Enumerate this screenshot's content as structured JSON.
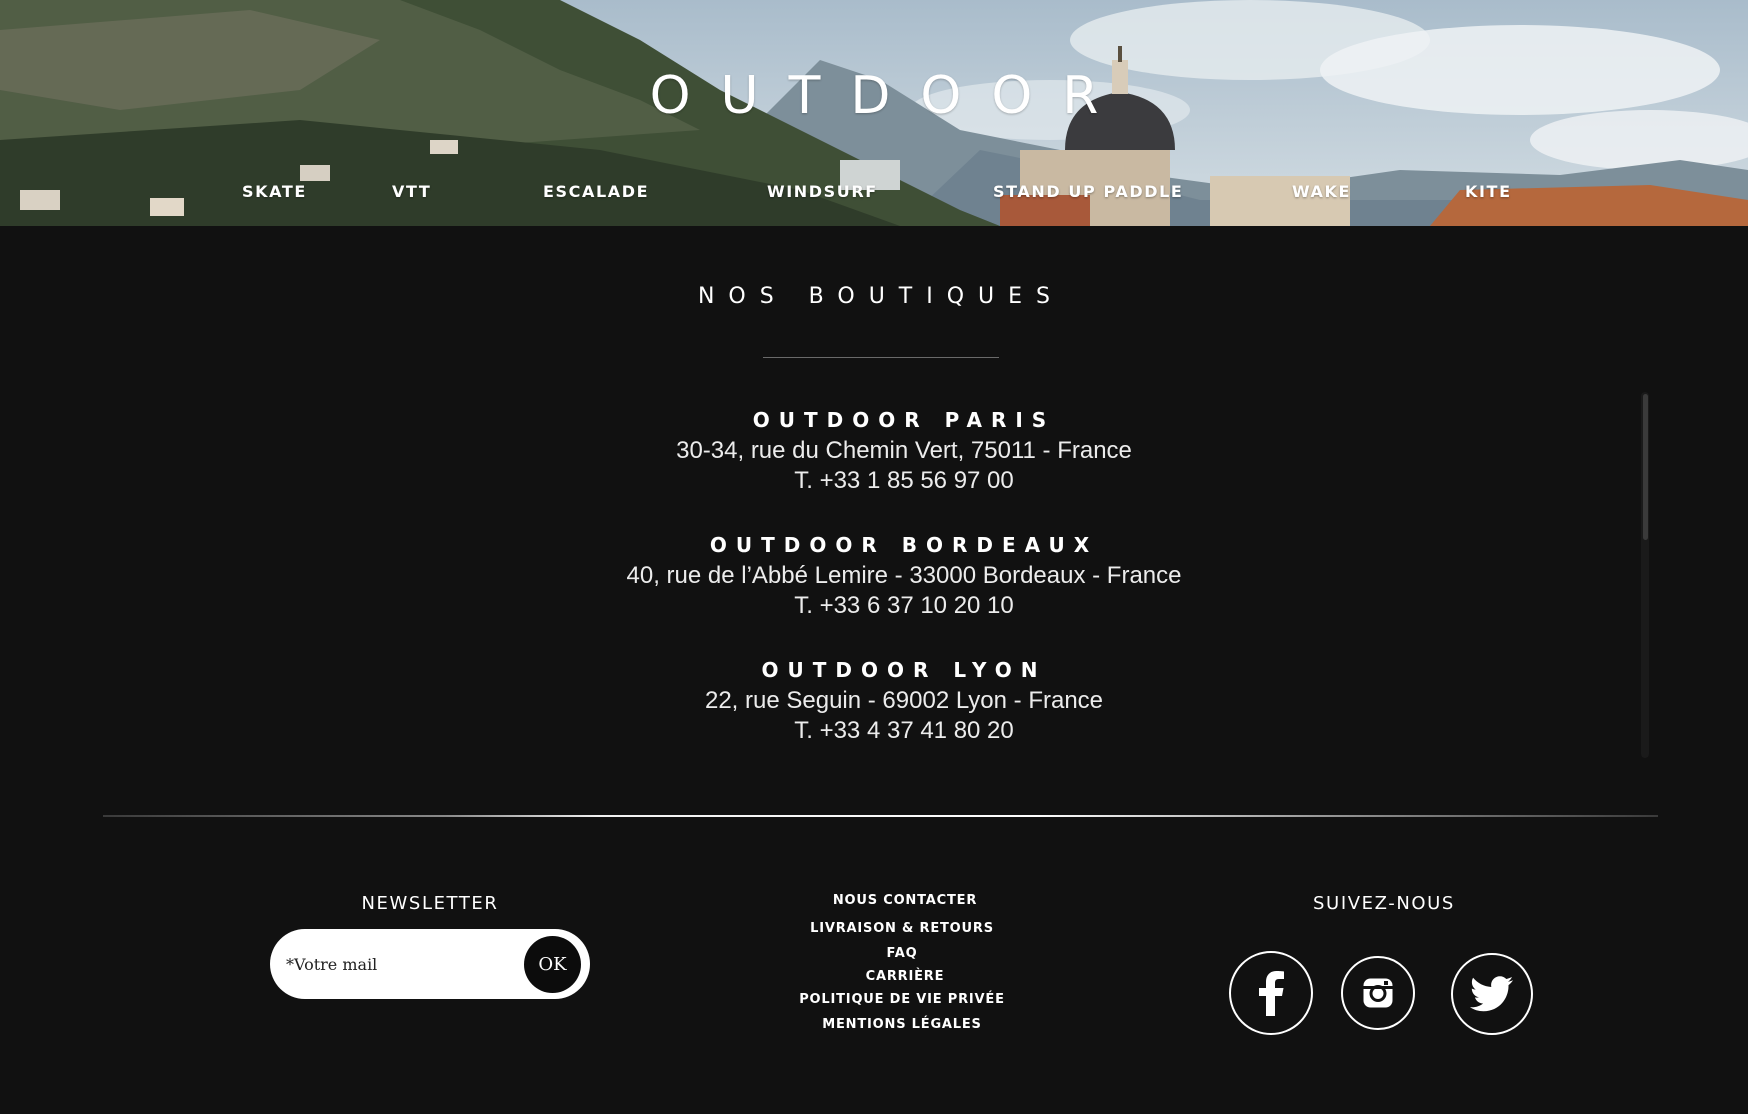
{
  "hero": {
    "title": "OUTDOOR",
    "nav": [
      "SKATE",
      "VTT",
      "ESCALADE",
      "WINDSURF",
      "STAND UP PADDLE",
      "WAKE",
      "KITE"
    ]
  },
  "boutiques": {
    "title": "NOS BOUTIQUES",
    "stores": [
      {
        "name": "OUTDOOR PARIS",
        "address": "30-34, rue du Chemin Vert, 75011 - France",
        "phone": "T. +33 1 85 56 97 00"
      },
      {
        "name": "OUTDOOR BORDEAUX",
        "address": "40, rue de l’Abbé Lemire - 33000 Bordeaux - France",
        "phone": "T. +33 6 37 10 20 10"
      },
      {
        "name": "OUTDOOR LYON",
        "address": "22, rue Seguin - 69002 Lyon - France",
        "phone": "T. +33 4 37 41 80 20"
      }
    ]
  },
  "footer": {
    "newsletter": {
      "title": "NEWSLETTER",
      "placeholder": "*Votre mail",
      "button": "OK"
    },
    "links": [
      "NOUS CONTACTER",
      "LIVRAISON & RETOURS",
      "FAQ",
      "CARRIÈRE",
      "POLITIQUE DE VIE PRIVÉE",
      "MENTIONS LÉGALES"
    ],
    "social": {
      "title": "SUIVEZ-NOUS",
      "icons": [
        "facebook-icon",
        "instagram-icon",
        "twitter-icon"
      ]
    }
  },
  "colors": {
    "background": "#111111",
    "text": "#ffffff"
  }
}
